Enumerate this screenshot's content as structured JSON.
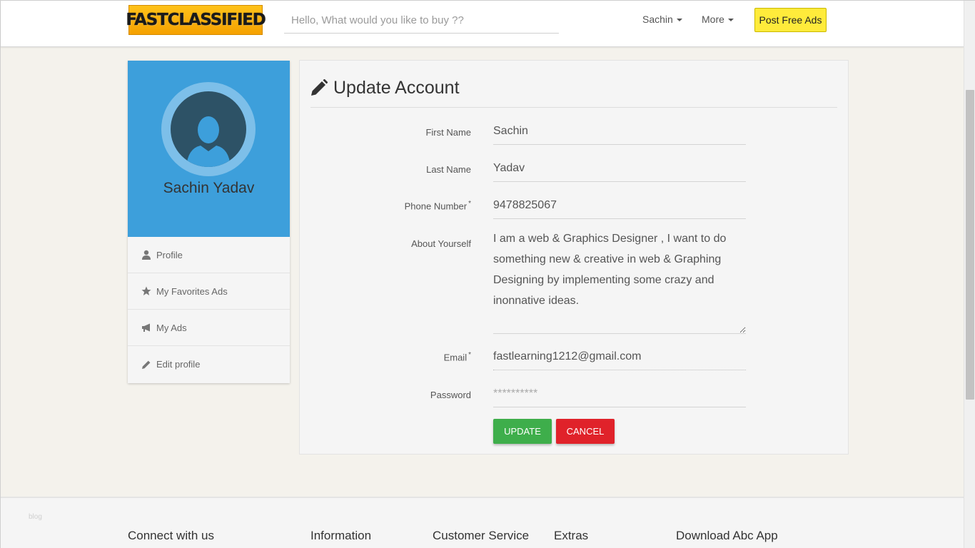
{
  "header": {
    "logo_text": "FASTCLASSIFIED",
    "search_placeholder": "Hello, What would you like to buy ??",
    "user_menu": "Sachin",
    "more_menu": "More",
    "post_button": "Post Free Ads"
  },
  "sidebar": {
    "user_name": "Sachin Yadav",
    "items": [
      {
        "label": "Profile",
        "icon": "user-icon"
      },
      {
        "label": "My Favorites Ads",
        "icon": "star-icon"
      },
      {
        "label": "My Ads",
        "icon": "megaphone-icon"
      },
      {
        "label": "Edit profile",
        "icon": "pencil-icon"
      }
    ]
  },
  "form": {
    "title": "Update Account",
    "first_name": {
      "label": "First Name",
      "value": "Sachin"
    },
    "last_name": {
      "label": "Last Name",
      "value": "Yadav"
    },
    "phone": {
      "label": "Phone Number",
      "required": "*",
      "value": "9478825067"
    },
    "about": {
      "label": "About Yourself",
      "value": "I am a web & Graphics Designer , I want to do something new & creative in web & Graphing Designing by implementing some crazy and inonnative ideas."
    },
    "email": {
      "label": "Email",
      "required": "*",
      "value": "fastlearning1212@gmail.com"
    },
    "password": {
      "label": "Password",
      "placeholder": "**********"
    },
    "update_button": "UPDATE",
    "cancel_button": "CANCEL"
  },
  "footer": {
    "blog": "blog",
    "columns": [
      "Connect with us",
      "Information",
      "Customer Service",
      "Extras",
      "Download Abc App"
    ]
  },
  "colors": {
    "profile_blue": "#3d9fdb",
    "post_yellow": "#ffeb3b",
    "update_green": "#3eae4b",
    "cancel_red": "#e0222a"
  }
}
